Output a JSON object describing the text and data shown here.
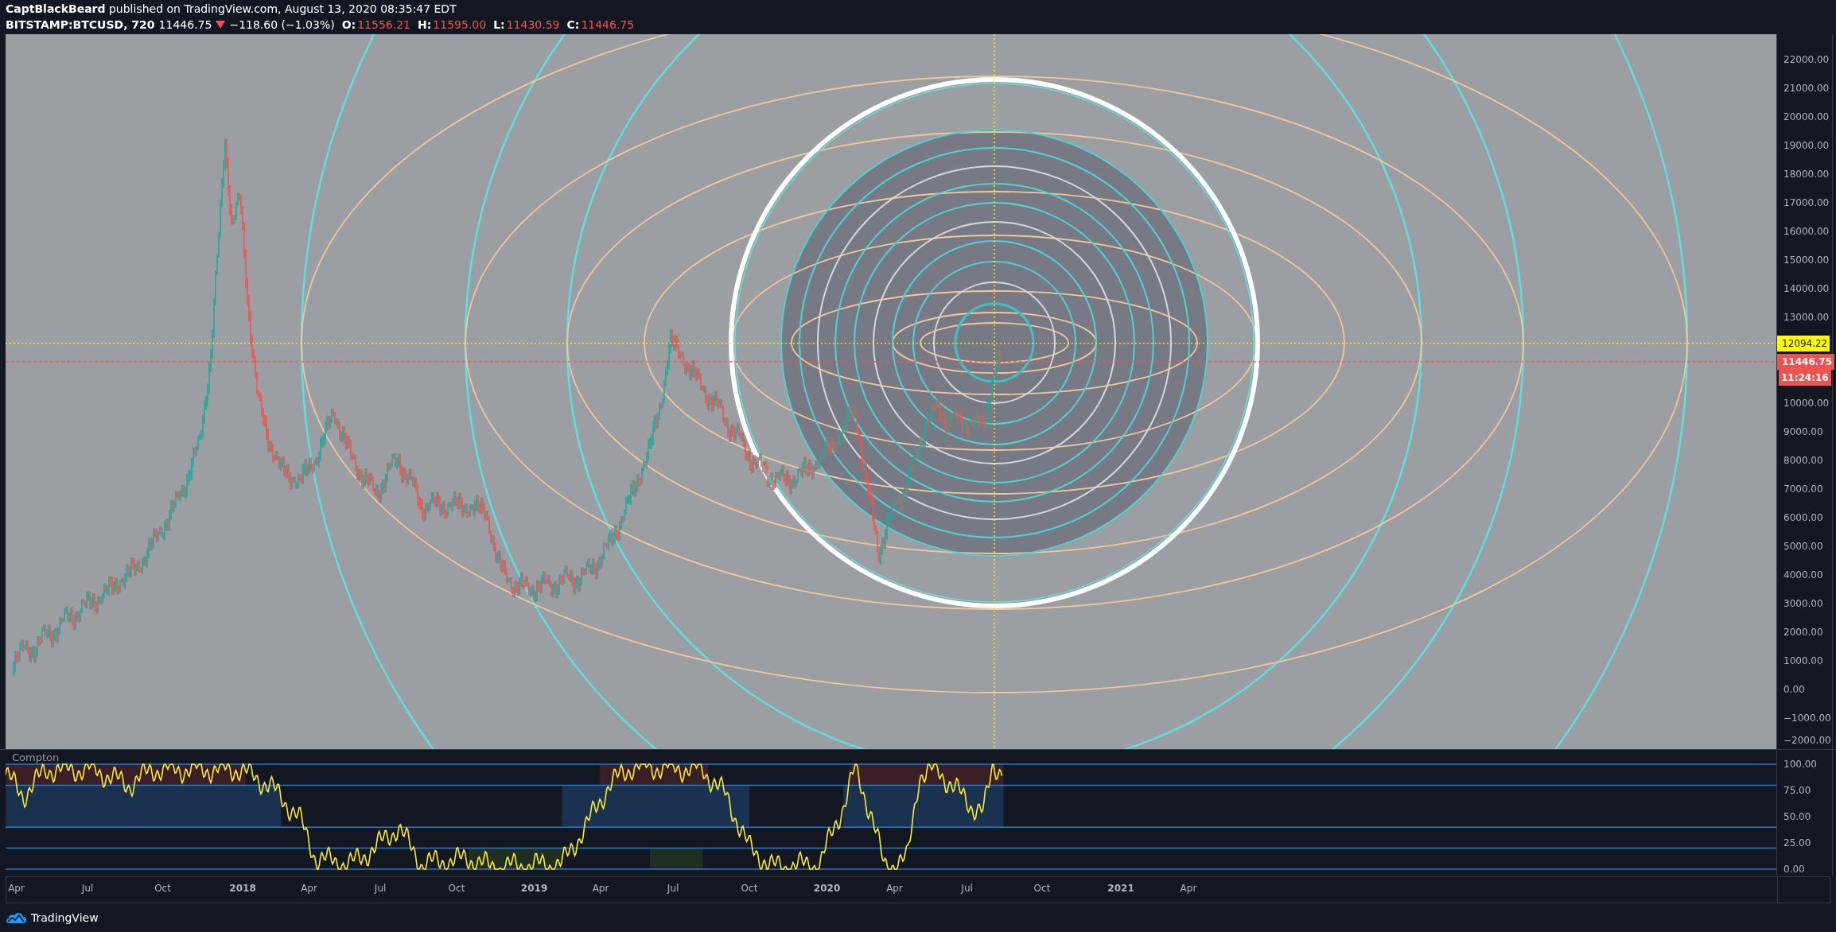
{
  "header": {
    "author": "CaptBlackBeard",
    "published": "published on TradingView.com, August 13, 2020 08:35:47 EDT"
  },
  "symbol_bar": {
    "symbol": "BITSTAMP:BTCUSD, 720",
    "last": "11446.75",
    "falling": true,
    "change": "−118.60 (−1.03%)",
    "ohlc": [
      {
        "label": "O:",
        "value": "11556.21"
      },
      {
        "label": "H:",
        "value": "11595.00"
      },
      {
        "label": "L:",
        "value": "11430.59"
      },
      {
        "label": "C:",
        "value": "11446.75"
      }
    ]
  },
  "price_axis": {
    "labels": [
      "22000.00",
      "21000.00",
      "20000.00",
      "19000.00",
      "18000.00",
      "17000.00",
      "16000.00",
      "15000.00",
      "14000.00",
      "13000.00",
      "10000.00",
      "9000.00",
      "8000.00",
      "7000.00",
      "6000.00",
      "5000.00",
      "4000.00",
      "3000.00",
      "2000.00",
      "1000.00",
      "0.00",
      "−1000.00",
      "−2000.00"
    ],
    "markers": [
      {
        "kind": "level",
        "text": "12094.22"
      },
      {
        "kind": "price",
        "text": "11446.75"
      },
      {
        "kind": "countdown",
        "text": "11:24:16"
      }
    ]
  },
  "indicator": {
    "name": "Compton",
    "axis_labels": [
      "100.00",
      "75.00",
      "50.00",
      "25.00",
      "0.00"
    ]
  },
  "time_axis": {
    "labels": [
      {
        "text": "Apr",
        "year": false
      },
      {
        "text": "Jul",
        "year": false
      },
      {
        "text": "Oct",
        "year": false
      },
      {
        "text": "2018",
        "year": true
      },
      {
        "text": "Apr",
        "year": false
      },
      {
        "text": "Jul",
        "year": false
      },
      {
        "text": "Oct",
        "year": false
      },
      {
        "text": "2019",
        "year": true
      },
      {
        "text": "Apr",
        "year": false
      },
      {
        "text": "Jul",
        "year": false
      },
      {
        "text": "Oct",
        "year": false
      },
      {
        "text": "2020",
        "year": true
      },
      {
        "text": "Apr",
        "year": false
      },
      {
        "text": "Jul",
        "year": false
      },
      {
        "text": "Oct",
        "year": false
      },
      {
        "text": "2021",
        "year": true
      },
      {
        "text": "Apr",
        "year": false
      }
    ]
  },
  "footer": {
    "brand": "TradingView"
  }
}
